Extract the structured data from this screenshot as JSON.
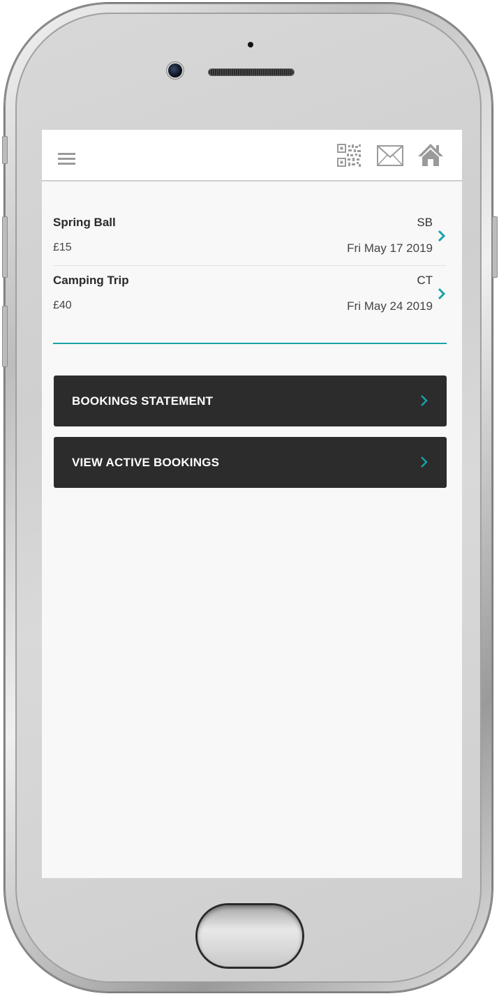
{
  "header": {
    "menu_icon": "hamburger-menu-icon",
    "qr_icon": "qr-code-icon",
    "mail_icon": "mail-icon",
    "home_icon": "home-icon"
  },
  "bookings": [
    {
      "name": "Spring Ball",
      "code": "SB",
      "price": "£15",
      "date": "Fri May 17 2019"
    },
    {
      "name": "Camping Trip",
      "code": "CT",
      "price": "£40",
      "date": "Fri May 24 2019"
    }
  ],
  "actions": {
    "statement_label": "BOOKINGS STATEMENT",
    "active_label": "VIEW ACTIVE BOOKINGS"
  },
  "colors": {
    "accent": "#17a2a8",
    "button_bg": "#2c2c2c",
    "screen_bg": "#f8f8f8"
  }
}
